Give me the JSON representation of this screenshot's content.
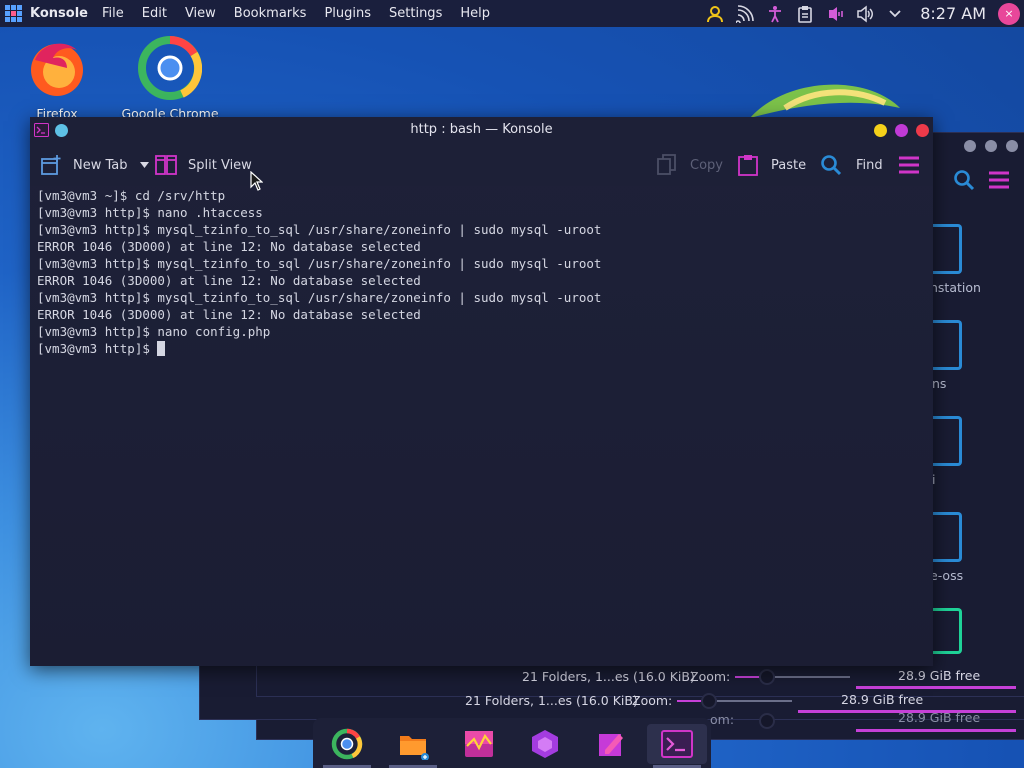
{
  "panel": {
    "app_name": "Konsole",
    "menu": [
      "File",
      "Edit",
      "View",
      "Bookmarks",
      "Plugins",
      "Settings",
      "Help"
    ],
    "clock": "8:27 AM",
    "tray_icons": [
      "user-icon",
      "network-icon",
      "accessibility-icon",
      "clipboard-icon",
      "microphone-icon",
      "volume-icon",
      "chevron-down-icon"
    ]
  },
  "desktop": {
    "icons": [
      {
        "label": "Firefox",
        "icon": "firefox-icon"
      },
      {
        "label": "Google Chrome",
        "icon": "chrome-icon"
      }
    ]
  },
  "background_windows": {
    "status_1": "21 Folders, 1...es (16.0 KiB)",
    "zoom_label": "Zoom:",
    "free_1": "28.9 GiB free",
    "status_2": "21 Folders, 1...es (16.0 KiB)",
    "free_2": "28.9 GiB free",
    "free_3": "28.9 GiB free",
    "zoom_label_3": "om:",
    "places": [
      "nstation",
      "ns",
      "i",
      "e-oss"
    ]
  },
  "konsole": {
    "title": "http : bash — Konsole",
    "toolbar": {
      "new_tab": "New Tab",
      "split_view": "Split View",
      "copy": "Copy",
      "paste": "Paste",
      "find": "Find"
    },
    "lines": [
      "[vm3@vm3 ~]$ cd /srv/http",
      "[vm3@vm3 http]$ nano .htaccess",
      "[vm3@vm3 http]$ mysql_tzinfo_to_sql /usr/share/zoneinfo | sudo mysql -uroot",
      "ERROR 1046 (3D000) at line 12: No database selected",
      "[vm3@vm3 http]$ mysql_tzinfo_to_sql /usr/share/zoneinfo | sudo mysql -uroot",
      "ERROR 1046 (3D000) at line 12: No database selected",
      "[vm3@vm3 http]$ mysql_tzinfo_to_sql /usr/share/zoneinfo | sudo mysql -uroot",
      "ERROR 1046 (3D000) at line 12: No database selected",
      "[vm3@vm3 http]$ nano config.php"
    ],
    "prompt": "[vm3@vm3 http]$ "
  },
  "taskbar": {
    "apps": [
      "chrome-icon",
      "dolphin-icon",
      "system-monitor-icon",
      "discover-icon",
      "kate-icon",
      "konsole-icon"
    ]
  },
  "colors": {
    "accent": "#c640d8",
    "panel_bg": "#1a1f3d",
    "window_bg": "#1d2037",
    "blue_icon": "#2a8bd6"
  }
}
